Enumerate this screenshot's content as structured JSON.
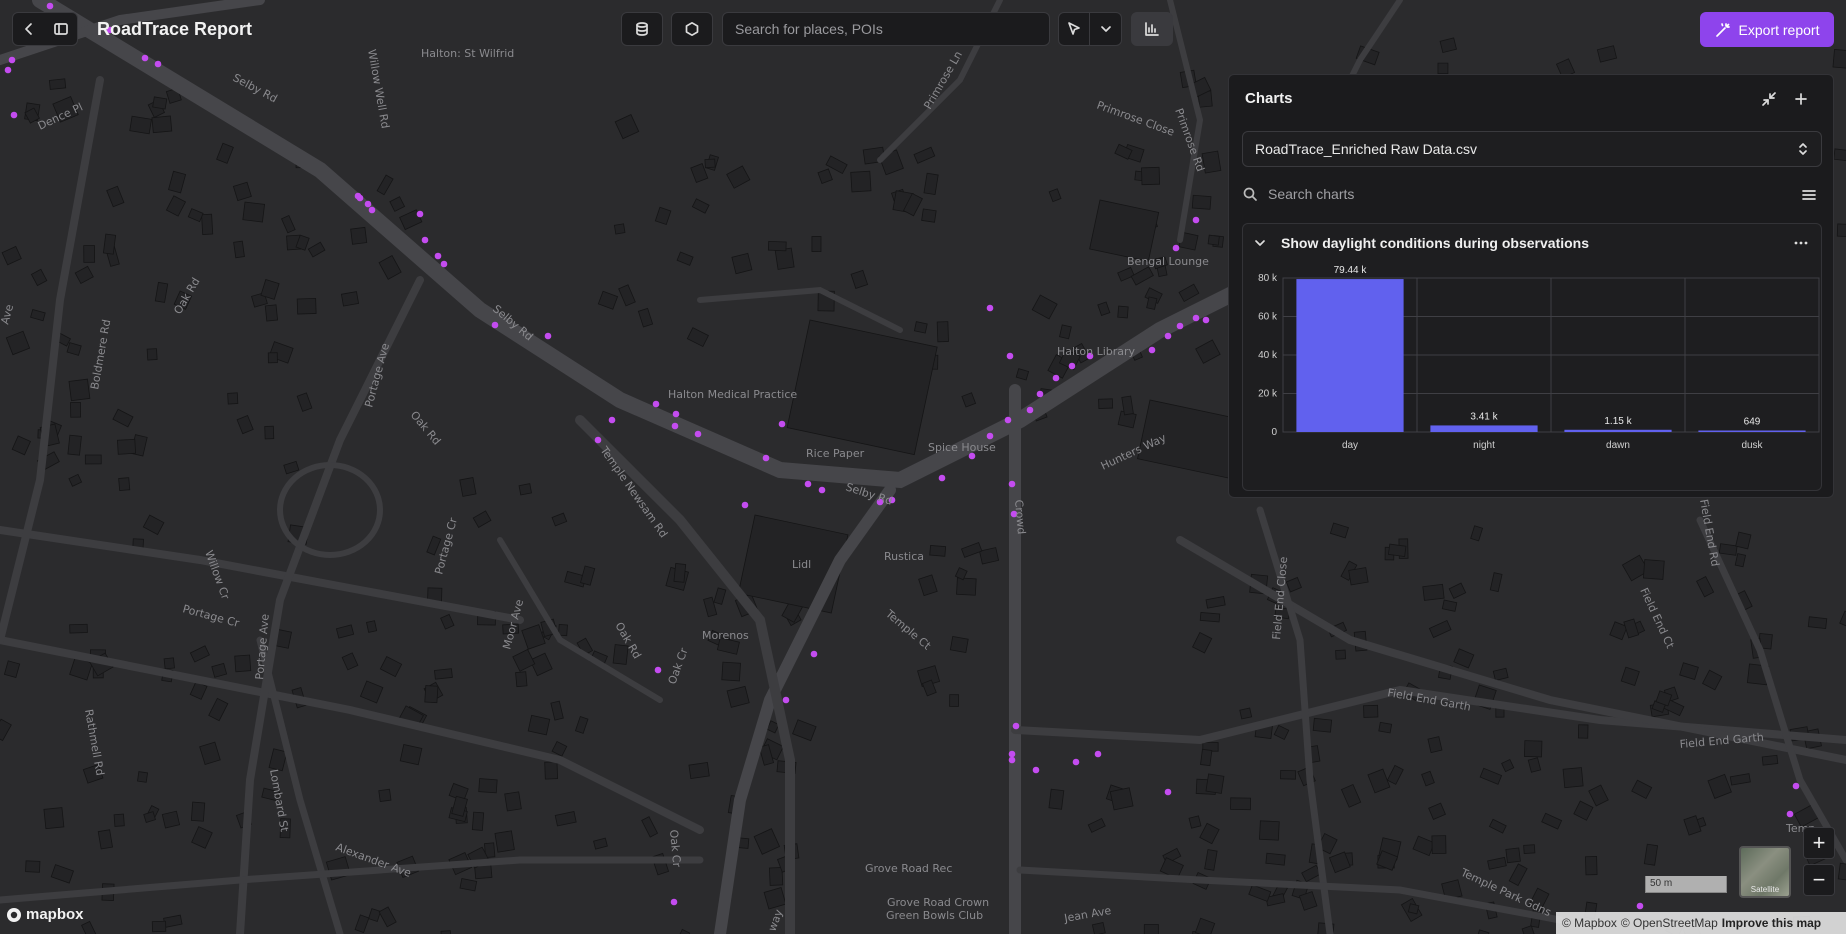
{
  "app": {
    "title": "RoadTrace Report",
    "accent": "#8e44ec",
    "point_color": "#c44cf0"
  },
  "toolbar": {
    "back_icon": "chevron-left-icon",
    "sidebar_icon": "sidebar-icon",
    "database_icon": "database-icon",
    "polygon_icon": "hexagon-icon",
    "search_placeholder": "Search for places, POIs",
    "cursor_icon": "cursor-icon",
    "dropdown_icon": "chevron-down-icon",
    "chart_icon": "chart-icon",
    "export_label": "Export report",
    "export_icon": "magic-wand-icon"
  },
  "charts_panel": {
    "title": "Charts",
    "dataset": "RoadTrace_Enriched Raw Data.csv",
    "search_placeholder": "Search charts",
    "card_title": "Show daylight conditions during observations"
  },
  "chart_data": {
    "type": "bar",
    "categories": [
      "day",
      "night",
      "dawn",
      "dusk"
    ],
    "values": [
      79440,
      3410,
      1150,
      649
    ],
    "value_labels": [
      "79.44 k",
      "3.41 k",
      "1.15 k",
      "649"
    ],
    "ylim": [
      0,
      80000
    ],
    "y_ticks": [
      0,
      20000,
      40000,
      60000,
      80000
    ],
    "y_tick_labels": [
      "0",
      "20 k",
      "40 k",
      "60 k",
      "80 k"
    ],
    "bar_color": "#6161ee",
    "grid": true,
    "title": "",
    "xlabel": "",
    "ylabel": ""
  },
  "map": {
    "labels": {
      "halton_st_wilfrid": "Halton: St Wilfrid",
      "selby_rd_1": "Selby Rd",
      "selby_rd_2": "Selby Rd",
      "selby_rd_3": "Selby Rd",
      "dence_pl": "Dence Pl",
      "willow_well_rd": "Willow Well Rd",
      "primrose_ln": "Primrose Ln",
      "primrose_close": "Primrose Close",
      "primrose_rd": "Primrose Rd",
      "bellmere_rd": "Boldmere Rd",
      "oak_rd_1": "Oak Rd",
      "oak_rd_2": "Oak Rd",
      "oak_rd_3": "Oak Rd",
      "portage_ave_1": "Portage Ave",
      "portage_ave_2": "Portage Ave",
      "portage_cr_1": "Portage Cr",
      "portage_cr_2": "Portage Cr",
      "halton_medical": "Halton Medical Practice",
      "rice_paper": "Rice Paper",
      "spice_house": "Spice House",
      "halton_library": "Halton Library",
      "bengal_lounge": "Bengal Lounge",
      "hunters_way": "Hunters Way",
      "temple_newsam": "Temple Newsam Rd",
      "lidl": "Lidl",
      "rustica": "Rustica",
      "temple_ct": "Temple Ct",
      "morenos": "Morenos",
      "moor_ave": "Moor Ave",
      "oak_cr_1": "Oak Cr",
      "oak_cr_2": "Oak Cr",
      "willow_cr": "Willow Cr",
      "field_end_close": "Field End Close",
      "field_end_garth_1": "Field End Garth",
      "field_end_garth_2": "Field End Garth",
      "field_end_ct": "Field End Ct",
      "field_end_rd": "Field End Rd",
      "grove_road_rec": "Grove Road Rec",
      "grove_road_crown": "Grove Road Crown",
      "green_bowls": "Green Bowls Club",
      "alexander_ave": "Alexander Ave",
      "lombard_st": "Lombard St",
      "rathmell_rd": "Rathmell Rd",
      "jean_ave": "Jean Ave",
      "temple_park_gdns": "Temple Park Gdns",
      "temp": "Temp",
      "ave": "Ave",
      "way": "way",
      "crowd": "Crowd"
    },
    "zoom_in_label": "+",
    "zoom_out_label": "−",
    "satellite_label": "Satellite",
    "scale_label": "50 m",
    "logo_text": "mapbox",
    "attribution": {
      "mapbox": "© Mapbox",
      "osm": "© OpenStreetMap",
      "improve": "Improve this map"
    }
  }
}
